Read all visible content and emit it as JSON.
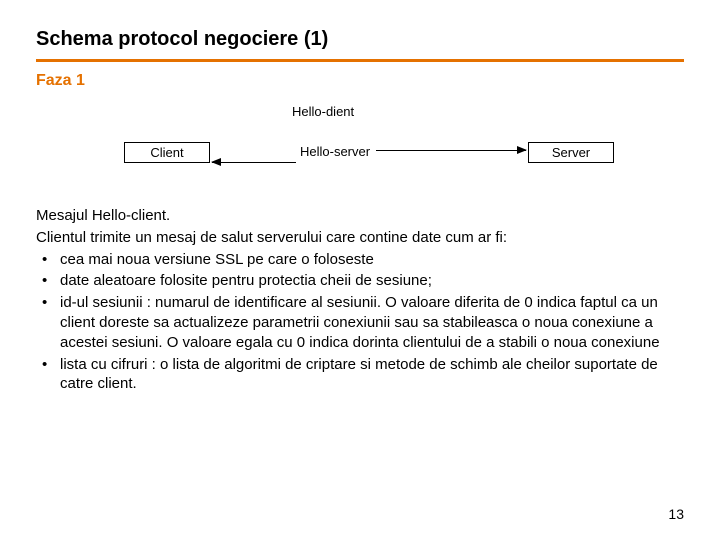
{
  "title": "Schema protocol negociere (1)",
  "phase": "Faza 1",
  "diagram": {
    "client_label": "Client",
    "server_label": "Server",
    "msg_top": "Hello-dient",
    "msg_mid": "Hello-server"
  },
  "message_title": "Mesajul Hello-client.",
  "intro": "Clientul trimite un mesaj de salut serverului care contine date cum ar fi:",
  "bullets": [
    "cea mai noua versiune SSL pe care o foloseste",
    "date aleatoare folosite pentru protectia cheii de sesiune;",
    "id-ul sesiunii : numarul de identificare al sesiunii. O valoare diferita de 0 indica faptul ca un client doreste sa actualizeze parametrii conexiunii sau sa stabileasca o noua conexiune a acestei sesiuni. O valoare egala cu 0 indica dorinta clientului de a stabili o noua conexiune",
    "lista cu cifruri : o lista de algoritmi de criptare si metode de schimb ale cheilor suportate de catre client."
  ],
  "page_number": "13"
}
